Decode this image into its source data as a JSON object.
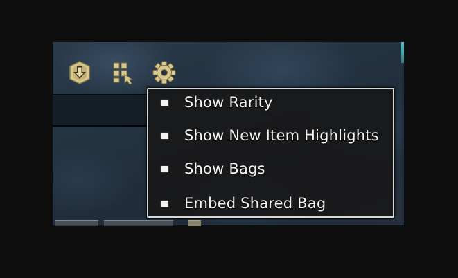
{
  "toolbar": {
    "icons": [
      {
        "name": "deposit-all-icon",
        "color": "#d9c98f"
      },
      {
        "name": "compact-inventory-icon",
        "color": "#d9c98f"
      },
      {
        "name": "gear-icon",
        "color": "#d9c98f"
      }
    ]
  },
  "options_menu": {
    "items": [
      {
        "label": "Show Rarity"
      },
      {
        "label": "Show New Item Highlights"
      },
      {
        "label": "Show Bags"
      },
      {
        "label": "Embed Shared Bag"
      }
    ]
  },
  "colors": {
    "icon_gold": "#d9c98f",
    "menu_border": "#d8d8d8",
    "menu_bg": "#18181a",
    "menu_text": "#f4f4f4"
  }
}
